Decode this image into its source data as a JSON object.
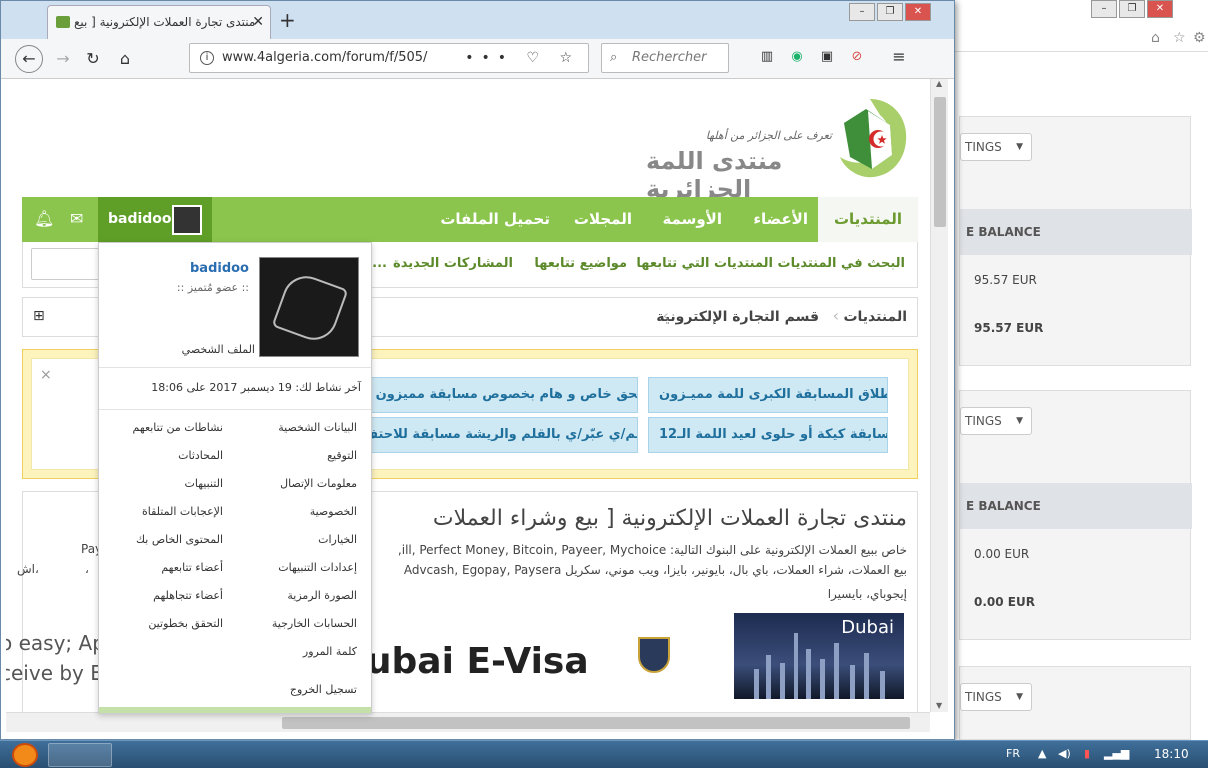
{
  "browser": {
    "tab_title": "منتدى تجارة العملات الإلكترونية [ بيع",
    "url": "www.4algeria.com/forum/f/505/",
    "search_placeholder": "Rechercher",
    "page_actions": "••• ♡ ☆"
  },
  "site": {
    "logo_tagline": "تعرف على الجزائر من أهلها",
    "logo_title": "منتدى اللمة الجزائرية"
  },
  "nav": {
    "items": [
      "المنتديات",
      "الأعضاء",
      "الأوسمة",
      "المجلات",
      "تحميل الملفات"
    ],
    "username": "badidoo"
  },
  "subnav": {
    "items": [
      "البحث في المنتديات",
      "المنتديات التي تتابعها",
      "مواضيع تتابعها",
      "المشاركات الجديدة",
      "..."
    ]
  },
  "breadcrumb": {
    "items": [
      "المنتديات",
      "قسم التجارة الإلكترونية"
    ]
  },
  "notices": {
    "items": [
      "إنطلاق المسابقة الكبرى للمة مميـزون",
      "ملحق خاص و هام بخصوص مسابقة مميزون و",
      "مسابقة كيكة أو حلوى لعيد اللمة الـ12",
      "أرسم/ي عبّر/ي بالقلم والريشة مسابقة للاحتف"
    ],
    "close": "×"
  },
  "forum": {
    "title": "منتدى تجارة العملات الإلكترونية [ بيع وشراء العملات",
    "desc_line1": "خاص ببيع العملات الإلكترونية على البنوك التالية: ill, Perfect Money, Bitcoin, Payeer, Mychoice,",
    "desc_line1_left": "Pay",
    "desc_line2": "بيع العملات، شراء العملات، باي بال، بايونير، بايزا، ويب موني، سكريل Advcash, Egopay, Paysera",
    "desc_line2_left": "،",
    "desc_line2_tail": "اش،",
    "desc_line3": "إيجوباي، بايسيرا"
  },
  "ad": {
    "line1": "o easy; Apply and Pay Online",
    "line2": "ceive by Email, Print and Go!",
    "title": "Dubai E-Visa",
    "image_label": "Dubai"
  },
  "dropdown": {
    "name": "badidoo",
    "rank": ":: عضو مُتميز ::",
    "profile": "الملف الشخصي",
    "last_activity": "آخر نشاط لك: 19 ديسمبر 2017 على 18:06",
    "right_links": [
      "البيانات الشخصية",
      "التوقيع",
      "معلومات الإتصال",
      "الخصوصية",
      "الخيارات",
      "إعدادات التنبيهات",
      "الصورة الرمزية",
      "الحسابات الخارجية",
      "كلمة المرور",
      "تسجيل الخروج"
    ],
    "left_links": [
      "نشاطات من تتابعهم",
      "المحادثات",
      "التنبيهات",
      "الإعجابات المتلقاة",
      "المحتوى الخاص بك",
      "أعضاء تتابعهم",
      "أعضاء تتجاهلهم",
      "التحقق بخطوتين"
    ]
  },
  "background_window": {
    "settings_btn": "TINGS",
    "balance_header": "E BALANCE",
    "panels": [
      {
        "v1": "95.57 EUR",
        "v2": "95.57 EUR"
      },
      {
        "v1": "0.00 EUR",
        "v2": "0.00 EUR"
      }
    ]
  },
  "taskbar": {
    "lang": "FR",
    "time": "18:10"
  }
}
